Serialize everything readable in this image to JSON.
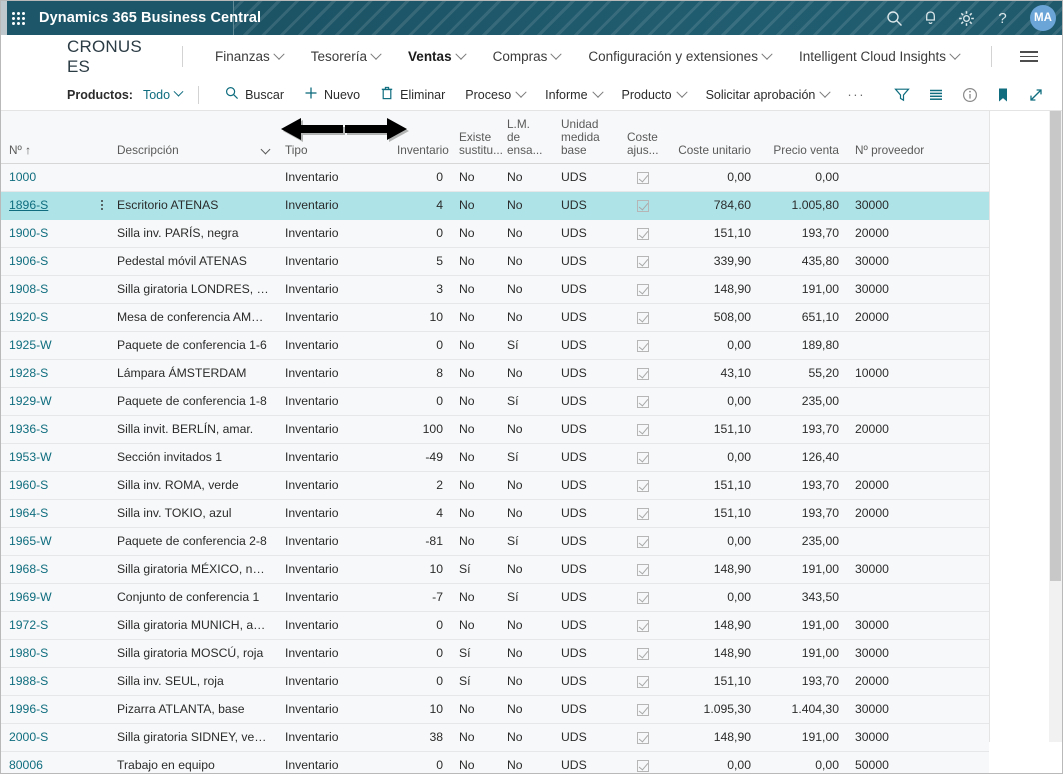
{
  "topbar": {
    "app_title": "Dynamics 365 Business Central",
    "waffle_icon": "app-launcher-icon",
    "icons": [
      "search-icon",
      "notification-bell-icon",
      "gear-icon",
      "help-question-icon"
    ],
    "avatar_initials": "MA",
    "background_color": "#1d5668",
    "avatar_color": "#6ba5d8"
  },
  "nav": {
    "company": "CRONUS ES",
    "items": [
      {
        "label": "Finanzas",
        "active": false
      },
      {
        "label": "Tesorería",
        "active": false
      },
      {
        "label": "Ventas",
        "active": true
      },
      {
        "label": "Compras",
        "active": false
      },
      {
        "label": "Configuración y extensiones",
        "active": false
      },
      {
        "label": "Intelligent Cloud Insights",
        "active": false
      }
    ],
    "hamburger_icon": "hamburger-menu-icon"
  },
  "actionbar": {
    "filter_label": "Productos:",
    "filter_value": "Todo",
    "items": [
      {
        "label": "Buscar",
        "icon": "search-icon",
        "caret": false
      },
      {
        "label": "Nuevo",
        "icon": "plus-icon",
        "caret": false
      },
      {
        "label": "Eliminar",
        "icon": "trash-icon",
        "caret": false
      },
      {
        "label": "Proceso",
        "icon": "",
        "caret": true
      },
      {
        "label": "Informe",
        "icon": "",
        "caret": true
      },
      {
        "label": "Producto",
        "icon": "",
        "caret": true
      },
      {
        "label": "Solicitar aprobación",
        "icon": "",
        "caret": true
      }
    ],
    "overflow_label": "···",
    "right_icons": [
      "filter-funnel-icon",
      "list-lines-icon",
      "info-circle-icon",
      "bookmark-icon",
      "expand-arrows-icon"
    ],
    "accent_color": "#0f6d7f"
  },
  "grid": {
    "columns": [
      {
        "key": "no",
        "label": "Nº ↑",
        "align": "left"
      },
      {
        "key": "descripcion",
        "label": "Descripción",
        "align": "left",
        "highlight": true,
        "caret": true
      },
      {
        "key": "tipo",
        "label": "Tipo",
        "align": "left"
      },
      {
        "key": "inventario",
        "label": "Inventario",
        "align": "right"
      },
      {
        "key": "existe_sustitu",
        "label": "Existe sustitu...",
        "align": "left"
      },
      {
        "key": "lm_ensa",
        "label": "L.M. de ensa...",
        "align": "left"
      },
      {
        "key": "unidad_medida",
        "label": "Unidad medida base",
        "align": "left"
      },
      {
        "key": "coste_ajus",
        "label": "Coste ajus...",
        "align": "center"
      },
      {
        "key": "coste_unitario",
        "label": "Coste unitario",
        "align": "right"
      },
      {
        "key": "precio_venta",
        "label": "Precio venta",
        "align": "right"
      },
      {
        "key": "no_proveedor",
        "label": "Nº proveedor",
        "align": "left"
      }
    ],
    "selected_row_index": 1,
    "selected_row_color": "#aee4e8",
    "header_highlight_color": "#d7eff1",
    "rows": [
      {
        "no": "1000",
        "descripcion": "",
        "tipo": "Inventario",
        "inventario": "0",
        "existe_sustitu": "No",
        "lm_ensa": "No",
        "unidad_medida": "UDS",
        "coste_ajus": true,
        "coste_unitario": "0,00",
        "precio_venta": "0,00",
        "no_proveedor": ""
      },
      {
        "no": "1896-S",
        "descripcion": "Escritorio ATENAS",
        "tipo": "Inventario",
        "inventario": "4",
        "existe_sustitu": "No",
        "lm_ensa": "No",
        "unidad_medida": "UDS",
        "coste_ajus": true,
        "coste_unitario": "784,60",
        "precio_venta": "1.005,80",
        "no_proveedor": "30000"
      },
      {
        "no": "1900-S",
        "descripcion": "Silla inv. PARÍS, negra",
        "tipo": "Inventario",
        "inventario": "0",
        "existe_sustitu": "No",
        "lm_ensa": "No",
        "unidad_medida": "UDS",
        "coste_ajus": true,
        "coste_unitario": "151,10",
        "precio_venta": "193,70",
        "no_proveedor": "20000"
      },
      {
        "no": "1906-S",
        "descripcion": "Pedestal móvil ATENAS",
        "tipo": "Inventario",
        "inventario": "5",
        "existe_sustitu": "No",
        "lm_ensa": "No",
        "unidad_medida": "UDS",
        "coste_ajus": true,
        "coste_unitario": "339,90",
        "precio_venta": "435,80",
        "no_proveedor": "30000"
      },
      {
        "no": "1908-S",
        "descripcion": "Silla giratoria LONDRES, azul",
        "tipo": "Inventario",
        "inventario": "3",
        "existe_sustitu": "No",
        "lm_ensa": "No",
        "unidad_medida": "UDS",
        "coste_ajus": true,
        "coste_unitario": "148,90",
        "precio_venta": "191,00",
        "no_proveedor": "30000"
      },
      {
        "no": "1920-S",
        "descripcion": "Mesa de conferencia AMBERES",
        "tipo": "Inventario",
        "inventario": "10",
        "existe_sustitu": "No",
        "lm_ensa": "No",
        "unidad_medida": "UDS",
        "coste_ajus": true,
        "coste_unitario": "508,00",
        "precio_venta": "651,10",
        "no_proveedor": "20000"
      },
      {
        "no": "1925-W",
        "descripcion": "Paquete de conferencia 1-6",
        "tipo": "Inventario",
        "inventario": "0",
        "existe_sustitu": "No",
        "lm_ensa": "Sí",
        "unidad_medida": "UDS",
        "coste_ajus": true,
        "coste_unitario": "0,00",
        "precio_venta": "189,80",
        "no_proveedor": ""
      },
      {
        "no": "1928-S",
        "descripcion": "Lámpara ÁMSTERDAM",
        "tipo": "Inventario",
        "inventario": "8",
        "existe_sustitu": "No",
        "lm_ensa": "No",
        "unidad_medida": "UDS",
        "coste_ajus": true,
        "coste_unitario": "43,10",
        "precio_venta": "55,20",
        "no_proveedor": "10000"
      },
      {
        "no": "1929-W",
        "descripcion": "Paquete de conferencia 1-8",
        "tipo": "Inventario",
        "inventario": "0",
        "existe_sustitu": "No",
        "lm_ensa": "Sí",
        "unidad_medida": "UDS",
        "coste_ajus": true,
        "coste_unitario": "0,00",
        "precio_venta": "235,00",
        "no_proveedor": ""
      },
      {
        "no": "1936-S",
        "descripcion": "Silla invit. BERLÍN, amar.",
        "tipo": "Inventario",
        "inventario": "100",
        "existe_sustitu": "No",
        "lm_ensa": "No",
        "unidad_medida": "UDS",
        "coste_ajus": true,
        "coste_unitario": "151,10",
        "precio_venta": "193,70",
        "no_proveedor": "20000"
      },
      {
        "no": "1953-W",
        "descripcion": "Sección invitados 1",
        "tipo": "Inventario",
        "inventario": "-49",
        "existe_sustitu": "No",
        "lm_ensa": "Sí",
        "unidad_medida": "UDS",
        "coste_ajus": true,
        "coste_unitario": "0,00",
        "precio_venta": "126,40",
        "no_proveedor": ""
      },
      {
        "no": "1960-S",
        "descripcion": "Silla inv. ROMA, verde",
        "tipo": "Inventario",
        "inventario": "2",
        "existe_sustitu": "No",
        "lm_ensa": "No",
        "unidad_medida": "UDS",
        "coste_ajus": true,
        "coste_unitario": "151,10",
        "precio_venta": "193,70",
        "no_proveedor": "20000"
      },
      {
        "no": "1964-S",
        "descripcion": "Silla inv. TOKIO, azul",
        "tipo": "Inventario",
        "inventario": "4",
        "existe_sustitu": "No",
        "lm_ensa": "No",
        "unidad_medida": "UDS",
        "coste_ajus": true,
        "coste_unitario": "151,10",
        "precio_venta": "193,70",
        "no_proveedor": "20000"
      },
      {
        "no": "1965-W",
        "descripcion": "Paquete de conferencia 2-8",
        "tipo": "Inventario",
        "inventario": "-81",
        "existe_sustitu": "No",
        "lm_ensa": "Sí",
        "unidad_medida": "UDS",
        "coste_ajus": true,
        "coste_unitario": "0,00",
        "precio_venta": "235,00",
        "no_proveedor": ""
      },
      {
        "no": "1968-S",
        "descripcion": "Silla giratoria MÉXICO, negra",
        "tipo": "Inventario",
        "inventario": "10",
        "existe_sustitu": "Sí",
        "lm_ensa": "No",
        "unidad_medida": "UDS",
        "coste_ajus": true,
        "coste_unitario": "148,90",
        "precio_venta": "191,00",
        "no_proveedor": "30000"
      },
      {
        "no": "1969-W",
        "descripcion": "Conjunto de conferencia 1",
        "tipo": "Inventario",
        "inventario": "-7",
        "existe_sustitu": "No",
        "lm_ensa": "Sí",
        "unidad_medida": "UDS",
        "coste_ajus": true,
        "coste_unitario": "0,00",
        "precio_venta": "343,50",
        "no_proveedor": ""
      },
      {
        "no": "1972-S",
        "descripcion": "Silla giratoria MUNICH, amar.",
        "tipo": "Inventario",
        "inventario": "0",
        "existe_sustitu": "No",
        "lm_ensa": "No",
        "unidad_medida": "UDS",
        "coste_ajus": true,
        "coste_unitario": "148,90",
        "precio_venta": "191,00",
        "no_proveedor": "30000"
      },
      {
        "no": "1980-S",
        "descripcion": "Silla giratoria MOSCÚ, roja",
        "tipo": "Inventario",
        "inventario": "0",
        "existe_sustitu": "Sí",
        "lm_ensa": "No",
        "unidad_medida": "UDS",
        "coste_ajus": true,
        "coste_unitario": "148,90",
        "precio_venta": "191,00",
        "no_proveedor": "30000"
      },
      {
        "no": "1988-S",
        "descripcion": "Silla inv. SEUL, roja",
        "tipo": "Inventario",
        "inventario": "0",
        "existe_sustitu": "Sí",
        "lm_ensa": "No",
        "unidad_medida": "UDS",
        "coste_ajus": true,
        "coste_unitario": "151,10",
        "precio_venta": "193,70",
        "no_proveedor": "20000"
      },
      {
        "no": "1996-S",
        "descripcion": "Pizarra ATLANTA, base",
        "tipo": "Inventario",
        "inventario": "10",
        "existe_sustitu": "No",
        "lm_ensa": "No",
        "unidad_medida": "UDS",
        "coste_ajus": true,
        "coste_unitario": "1.095,30",
        "precio_venta": "1.404,30",
        "no_proveedor": "30000"
      },
      {
        "no": "2000-S",
        "descripcion": "Silla giratoria SIDNEY, verde",
        "tipo": "Inventario",
        "inventario": "38",
        "existe_sustitu": "No",
        "lm_ensa": "No",
        "unidad_medida": "UDS",
        "coste_ajus": true,
        "coste_unitario": "148,90",
        "precio_venta": "191,00",
        "no_proveedor": "30000"
      },
      {
        "no": "80006",
        "descripcion": "Trabajo en equipo",
        "tipo": "Inventario",
        "inventario": "0",
        "existe_sustitu": "No",
        "lm_ensa": "No",
        "unidad_medida": "UDS",
        "coste_ajus": true,
        "coste_unitario": "0,00",
        "precio_venta": "0,00",
        "no_proveedor": "50000"
      }
    ]
  },
  "annotations": {
    "arrow_left": "left-arrow-annotation",
    "arrow_right": "right-arrow-annotation",
    "color": "#000000"
  }
}
